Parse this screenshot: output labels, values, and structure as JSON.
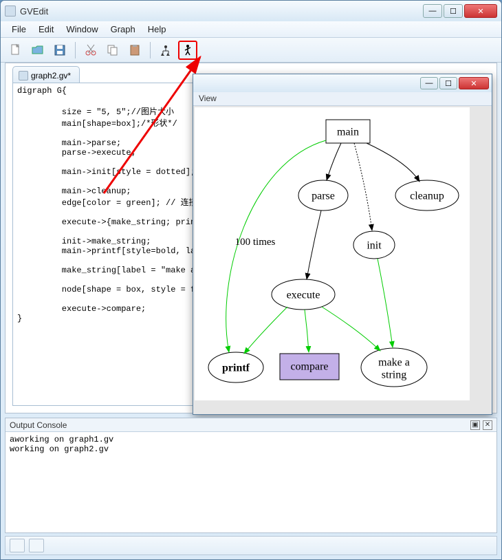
{
  "app": {
    "title": "GVEdit"
  },
  "menu": {
    "file": "File",
    "edit": "Edit",
    "window": "Window",
    "graph": "Graph",
    "help": "Help"
  },
  "tabs": {
    "editor": "graph2.gv*"
  },
  "code": "digraph G{\n\n         size = \"5, 5\";//图片大小\n         main[shape=box];/*形状*/\n\n         main->parse;\n         parse->execute;\n\n         main->init[style = dotted];//\n\n         main->cleanup;\n         edge[color = green]; // 连接线\n\n         execute->{make_string; print\n\n         init->make_string;\n         main->printf[style=bold, lab\n\n         make_string[label = \"make a\\n\n\n         node[shape = box, style = fil\n\n         execute->compare;\n}",
  "view": {
    "label": "View"
  },
  "graph": {
    "nodes": {
      "main": "main",
      "parse": "parse",
      "cleanup": "cleanup",
      "init": "init",
      "execute": "execute",
      "printf": "printf",
      "compare": "compare",
      "make_string_l1": "make a",
      "make_string_l2": "string"
    },
    "edge_labels": {
      "main_printf": "100 times"
    }
  },
  "console": {
    "title": "Output Console",
    "lines": "aworking on graph1.gv\nworking on graph2.gv"
  }
}
